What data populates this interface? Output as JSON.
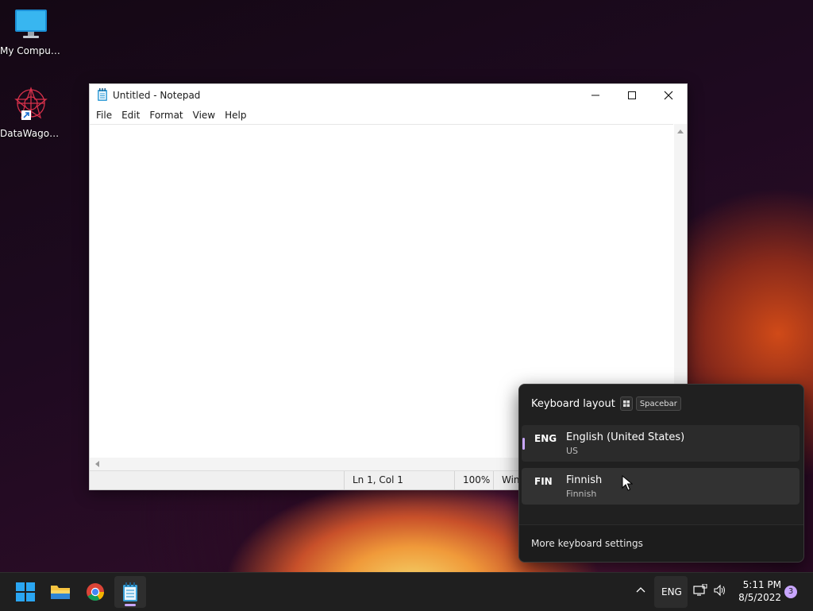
{
  "desktop": {
    "icons": [
      {
        "label": "My Computer"
      },
      {
        "label": "DataWagon..."
      }
    ]
  },
  "notepad": {
    "title": "Untitled - Notepad",
    "menu": [
      "File",
      "Edit",
      "Format",
      "View",
      "Help"
    ],
    "content": "",
    "status": {
      "position": "Ln 1, Col 1",
      "zoom": "100%",
      "line_ending": "Win"
    }
  },
  "keyboard_flyout": {
    "title": "Keyboard layout",
    "shortcut_key": "Spacebar",
    "languages": [
      {
        "code": "ENG",
        "name": "English (United States)",
        "layout": "US",
        "selected": true
      },
      {
        "code": "FIN",
        "name": "Finnish",
        "layout": "Finnish",
        "selected": false
      }
    ],
    "footer_link": "More keyboard settings"
  },
  "taskbar": {
    "apps": [
      "start-button",
      "file-explorer",
      "chrome",
      "notepad"
    ],
    "language_indicator": "ENG",
    "time": "5:11 PM",
    "date": "8/5/2022",
    "notification_count": "3"
  },
  "colors": {
    "accent": "#c9a6ff",
    "flyout_bg": "#202020",
    "taskbar_bg": "#1f1f1f"
  }
}
